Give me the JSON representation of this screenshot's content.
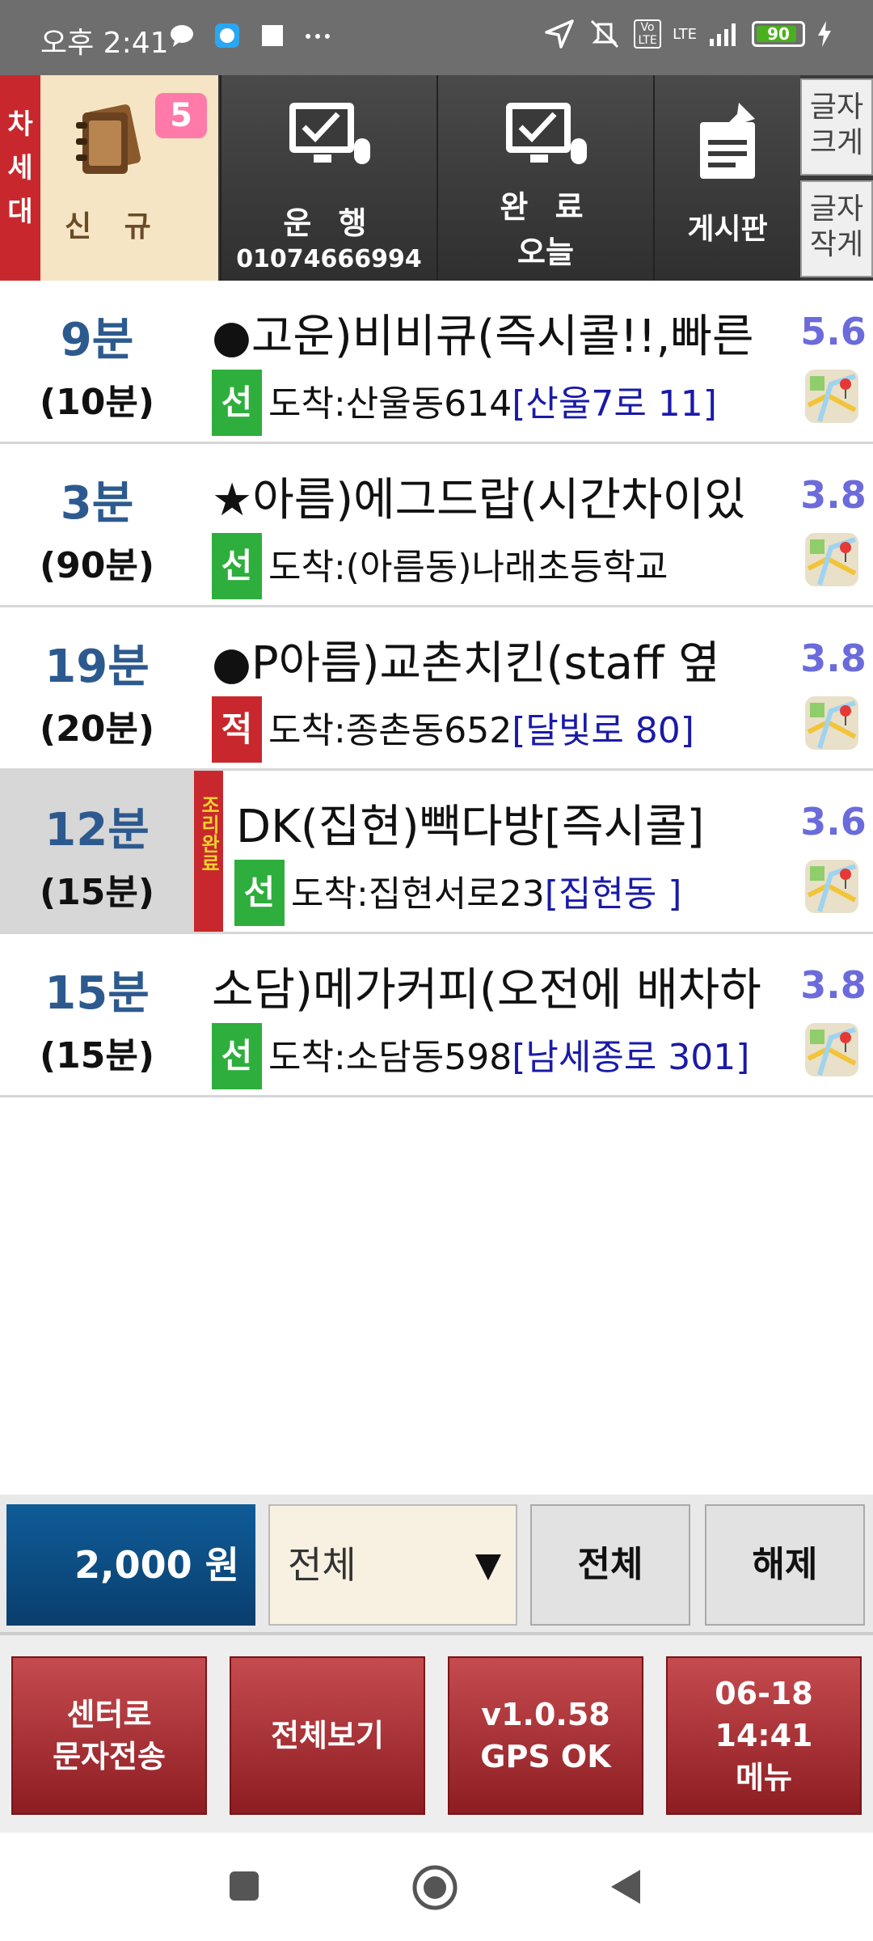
{
  "status": {
    "time": "오후 2:41",
    "network": "LTE",
    "volte": "Vo LTE",
    "battery": "90",
    "battery_level": 0.9
  },
  "toolbar": {
    "next_gen": [
      "차",
      "세",
      "대"
    ],
    "new_label": "신 규",
    "new_count": "5",
    "drive_label": "운 행",
    "drive_phone": "01074666994",
    "done_label": "완 료",
    "done_sub": "오늘",
    "board_label": "게시판",
    "font_large": [
      "글자",
      "크게"
    ],
    "font_small": [
      "글자",
      "작게"
    ]
  },
  "orders": [
    {
      "time": "9분",
      "limit": "(10분)",
      "title": "●고운)비비큐(즉시콜!!,빠른",
      "tag": "선",
      "dest": "도착:산울동614",
      "addr": "[산울7로 11]",
      "dist": "5.6",
      "tag_color": "#2eae3c"
    },
    {
      "time": "3분",
      "limit": "(90분)",
      "title": "★아름)에그드랍(시간차이있",
      "tag": "선",
      "dest": "도착:(아름동)나래초등학교",
      "addr": "",
      "dist": "3.8",
      "tag_color": "#2eae3c"
    },
    {
      "time": "19분",
      "limit": "(20분)",
      "title": "●P아름)교촌치킨(staff 옆",
      "tag": "적",
      "dest": "도착:종촌동652",
      "addr": "[달빛로 80]",
      "dist": "3.8",
      "tag_color": "#c8282d"
    },
    {
      "time": "12분",
      "limit": "(15분)",
      "cook": "조리완료",
      "title": "DK(집현)빽다방[즉시콜]",
      "tag": "선",
      "dest": "도착:집현서로23",
      "addr": "[집현동 ]",
      "dist": "3.6",
      "tag_color": "#2eae3c"
    },
    {
      "time": "15분",
      "limit": "(15분)",
      "title": "소담)메가커피(오전에 배차하",
      "tag": "선",
      "dest": "도착:소담동598",
      "addr": "[남세종로 301]",
      "dist": "3.8",
      "tag_color": "#2eae3c"
    }
  ],
  "controls": {
    "amount": "2,000 원",
    "filter_value": "전체",
    "all_label": "전체",
    "release_label": "해제"
  },
  "bottom": {
    "send_center": [
      "센터로",
      "문자전송"
    ],
    "view_all": "전체보기",
    "version": [
      "v1.0.58",
      "GPS OK"
    ],
    "menu": [
      "06-18 14:41",
      "메뉴"
    ]
  },
  "icons": [
    "message-bubble-icon",
    "messenger-icon",
    "square-icon",
    "more-icon",
    "location-arrow-icon",
    "mute-icon",
    "signal-icon",
    "battery-icon",
    "charging-icon",
    "notebook-icon",
    "monitor-check-icon",
    "clipboard-pin-icon",
    "map-icon",
    "dropdown-caret-icon",
    "nav-recents-icon",
    "nav-home-icon",
    "nav-back-icon"
  ]
}
